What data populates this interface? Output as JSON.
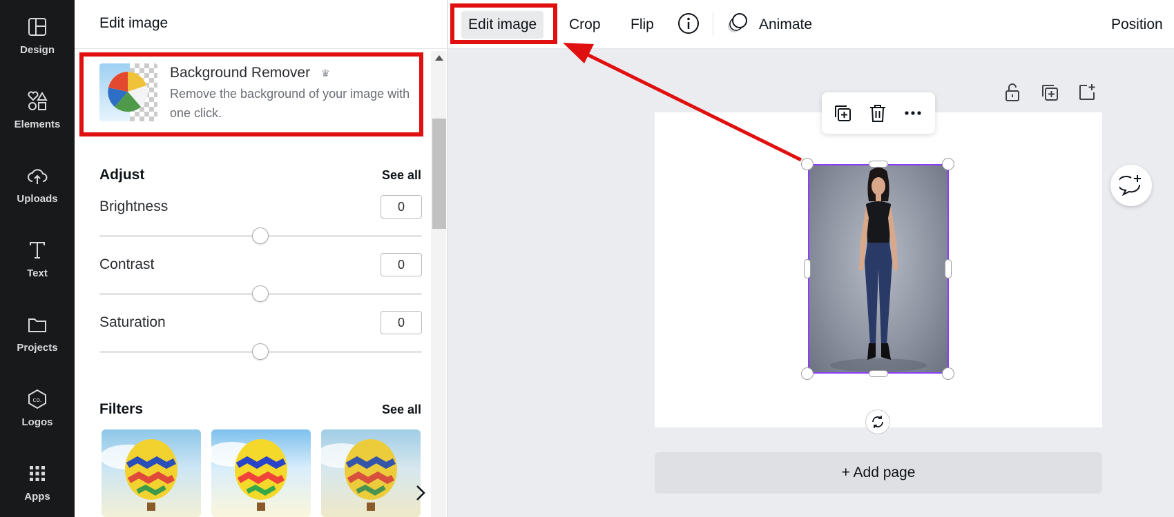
{
  "rail": {
    "items": [
      {
        "label": "Design",
        "icon": "layout-icon"
      },
      {
        "label": "Elements",
        "icon": "shapes-icon"
      },
      {
        "label": "Uploads",
        "icon": "cloud-upload-icon"
      },
      {
        "label": "Text",
        "icon": "text-t-icon"
      },
      {
        "label": "Projects",
        "icon": "folder-icon"
      },
      {
        "label": "Logos",
        "icon": "logo-co-icon"
      },
      {
        "label": "Apps",
        "icon": "grid-icon"
      }
    ]
  },
  "panel": {
    "title": "Edit image",
    "bg_remover": {
      "title": "Background Remover",
      "description": "Remove the background of your image with one click."
    },
    "adjust": {
      "title": "Adjust",
      "see_all": "See all",
      "items": [
        {
          "label": "Brightness",
          "value": "0"
        },
        {
          "label": "Contrast",
          "value": "0"
        },
        {
          "label": "Saturation",
          "value": "0"
        }
      ]
    },
    "filters": {
      "title": "Filters",
      "see_all": "See all"
    }
  },
  "toolbar": {
    "edit_image": "Edit image",
    "crop": "Crop",
    "flip": "Flip",
    "animate": "Animate",
    "position": "Position"
  },
  "canvas": {
    "add_page": "+ Add page"
  },
  "colors": {
    "selection": "#8b3dff",
    "highlight": "#e01010",
    "rail_bg": "#18191b"
  }
}
